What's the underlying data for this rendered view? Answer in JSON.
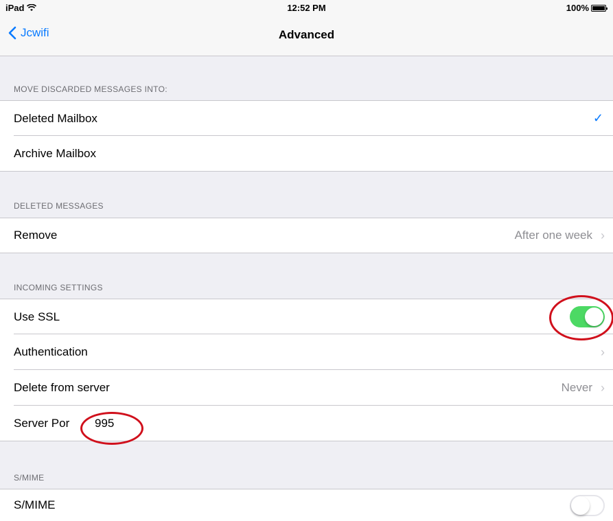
{
  "status_bar": {
    "device": "iPad",
    "time": "12:52 PM",
    "battery": "100%"
  },
  "nav": {
    "back_label": "Jcwifi",
    "title": "Advanced"
  },
  "sections": {
    "discarded": {
      "header": "MOVE DISCARDED MESSAGES INTO:",
      "deleted_mailbox": "Deleted Mailbox",
      "archive_mailbox": "Archive Mailbox",
      "selected": "Deleted Mailbox"
    },
    "deleted_messages": {
      "header": "DELETED MESSAGES",
      "remove_label": "Remove",
      "remove_value": "After one week"
    },
    "incoming": {
      "header": "INCOMING SETTINGS",
      "use_ssl_label": "Use SSL",
      "use_ssl_on": true,
      "authentication_label": "Authentication",
      "delete_from_server_label": "Delete from server",
      "delete_from_server_value": "Never",
      "server_port_label": "Server Por",
      "server_port_value": "995"
    },
    "smime": {
      "header": "S/MIME",
      "smime_label": "S/MIME",
      "smime_on": false
    }
  },
  "colors": {
    "accent": "#0a7bff",
    "toggle_on": "#4cd964",
    "annotation": "#d0101c"
  }
}
